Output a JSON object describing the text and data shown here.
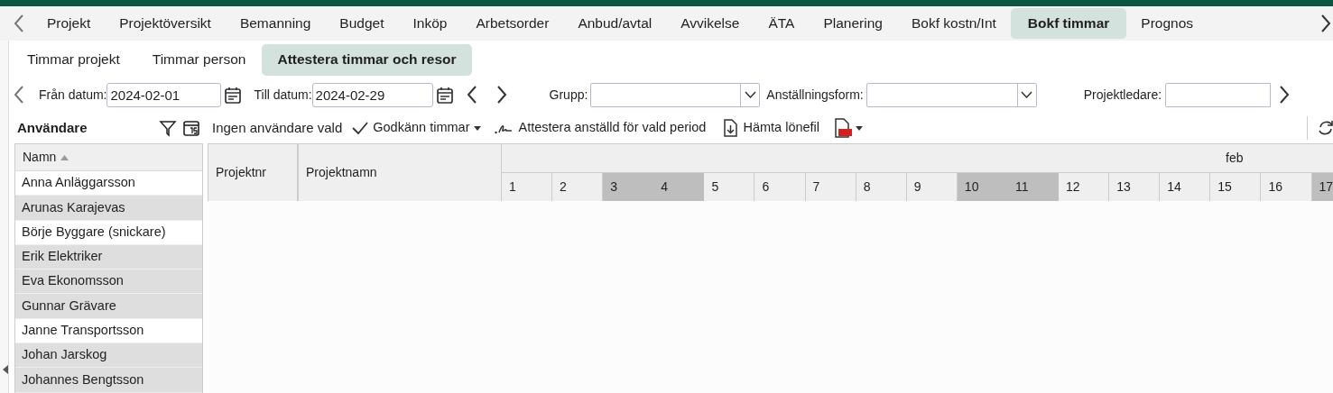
{
  "tabs": [
    {
      "label": "Projekt",
      "selected": false
    },
    {
      "label": "Projektöversikt",
      "selected": false
    },
    {
      "label": "Bemanning",
      "selected": false
    },
    {
      "label": "Budget",
      "selected": false
    },
    {
      "label": "Inköp",
      "selected": false
    },
    {
      "label": "Arbetsorder",
      "selected": false
    },
    {
      "label": "Anbud/avtal",
      "selected": false
    },
    {
      "label": "Avvikelse",
      "selected": false
    },
    {
      "label": "ÄTA",
      "selected": false
    },
    {
      "label": "Planering",
      "selected": false
    },
    {
      "label": "Bokf kostn/Int",
      "selected": false
    },
    {
      "label": "Bokf timmar",
      "selected": true
    },
    {
      "label": "Prognos",
      "selected": false
    }
  ],
  "subtabs": [
    {
      "label": "Timmar projekt",
      "selected": false
    },
    {
      "label": "Timmar person",
      "selected": false
    },
    {
      "label": "Attestera timmar och resor",
      "selected": true
    }
  ],
  "filters": {
    "from_label": "Från datum:",
    "from_value": "2024-02-01",
    "to_label": "Till datum:",
    "to_value": "2024-02-29",
    "group_label": "Grupp:",
    "employment_label": "Anställningsform:",
    "manager_label": "Projektledare:"
  },
  "users_panel": {
    "title": "Användare",
    "column": "Namn",
    "rows": [
      {
        "name": "Anna Anläggarsson",
        "highlighted": false
      },
      {
        "name": "Arunas Karajevas",
        "highlighted": true
      },
      {
        "name": "Börje Byggare (snickare)",
        "highlighted": false
      },
      {
        "name": "Erik Elektriker",
        "highlighted": true
      },
      {
        "name": "Eva Ekonomsson",
        "highlighted": true
      },
      {
        "name": "Gunnar Grävare",
        "highlighted": true
      },
      {
        "name": "Janne Transportsson",
        "highlighted": false
      },
      {
        "name": "Johan Jarskog",
        "highlighted": true
      },
      {
        "name": "Johannes Bengtsson",
        "highlighted": true
      }
    ]
  },
  "toolbar": {
    "status": "Ingen användare vald",
    "approve": "Godkänn timmar",
    "attest": "Attestera anställd för vald period",
    "download": "Hämta lönefil"
  },
  "grid": {
    "columns": [
      "Projektnr",
      "Projektnamn"
    ],
    "month": "feb",
    "days": [
      {
        "label": "1",
        "weekend": false
      },
      {
        "label": "2",
        "weekend": false
      },
      {
        "label": "3",
        "weekend": true
      },
      {
        "label": "4",
        "weekend": true
      },
      {
        "label": "5",
        "weekend": false
      },
      {
        "label": "6",
        "weekend": false
      },
      {
        "label": "7",
        "weekend": false
      },
      {
        "label": "8",
        "weekend": false
      },
      {
        "label": "9",
        "weekend": false
      },
      {
        "label": "10",
        "weekend": true
      },
      {
        "label": "11",
        "weekend": true
      },
      {
        "label": "12",
        "weekend": false
      },
      {
        "label": "13",
        "weekend": false
      },
      {
        "label": "14",
        "weekend": false
      },
      {
        "label": "15",
        "weekend": false
      },
      {
        "label": "16",
        "weekend": false
      },
      {
        "label": "17",
        "weekend": true
      }
    ]
  }
}
